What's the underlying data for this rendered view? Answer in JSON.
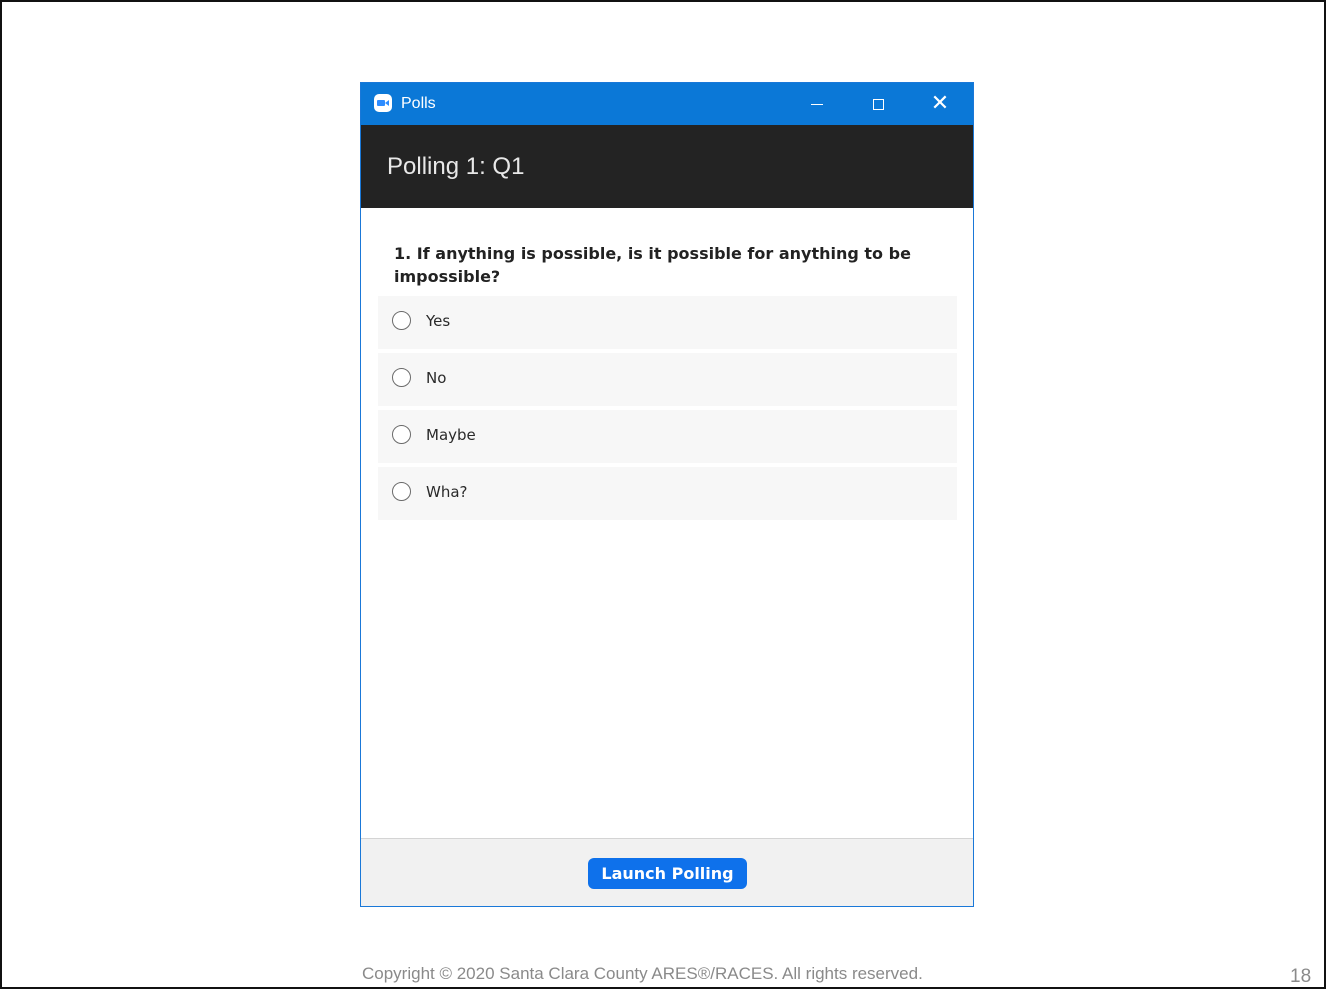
{
  "window": {
    "title": "Polls",
    "controls": {
      "minimize_icon": "minimize-icon",
      "maximize_icon": "maximize-icon",
      "close_icon": "close-icon",
      "close_glyph": "✕"
    },
    "app_icon": "zoom-camera-icon",
    "titlebar_color": "#0b78d7"
  },
  "header": {
    "title": "Polling 1: Q1"
  },
  "poll": {
    "question": "1. If anything is possible, is it possible for anything to be impossible?",
    "options": [
      {
        "label": "Yes"
      },
      {
        "label": "No"
      },
      {
        "label": "Maybe"
      },
      {
        "label": "Wha?"
      }
    ]
  },
  "footer": {
    "launch_label": "Launch Polling",
    "accent_color": "#0e71eb"
  },
  "slide": {
    "copyright": "Copyright © 2020 Santa Clara County ARES®/RACES.  All rights reserved.",
    "page_number": "18"
  }
}
